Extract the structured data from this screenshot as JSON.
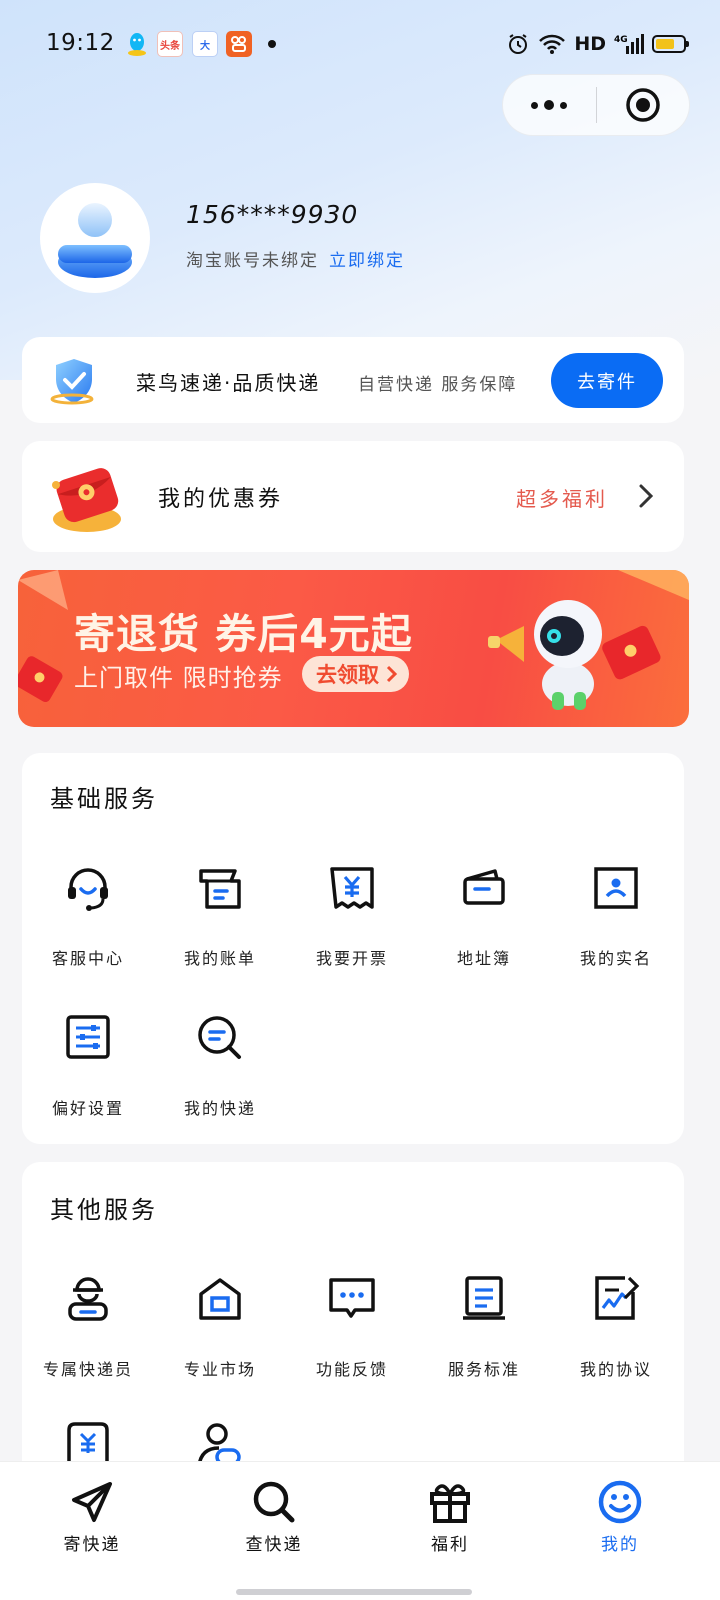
{
  "status_bar": {
    "time": "19:12",
    "network": "HD",
    "signal": "4G",
    "battery_level": 0.7
  },
  "status_icons": [
    {
      "name": "qq-icon",
      "color": "#12b7f5"
    },
    {
      "name": "toutiao-icon",
      "text": "头条",
      "color": "#e8453c"
    },
    {
      "name": "baidu-icon",
      "text": "大",
      "color": "#2e6bea"
    },
    {
      "name": "kuaishou-icon",
      "color": "#f06224"
    }
  ],
  "profile": {
    "phone": "156****9930",
    "bind_status": "淘宝账号未绑定",
    "bind_link": "立即绑定"
  },
  "promo": {
    "title": "菜鸟速递·品质快递",
    "subtitle": "自营快递 服务保障",
    "button": "去寄件"
  },
  "coupon": {
    "title": "我的优惠券",
    "right": "超多福利"
  },
  "banner": {
    "headline": "寄退货 券后4元起",
    "subline": "上门取件 限时抢券",
    "cta": "去领取"
  },
  "basic_services": {
    "title": "基础服务",
    "items": [
      {
        "label": "客服中心",
        "icon": "headset-icon"
      },
      {
        "label": "我的账单",
        "icon": "bill-icon"
      },
      {
        "label": "我要开票",
        "icon": "invoice-icon"
      },
      {
        "label": "地址簿",
        "icon": "address-book-icon"
      },
      {
        "label": "我的实名",
        "icon": "id-card-icon"
      },
      {
        "label": "偏好设置",
        "icon": "settings-sliders-icon"
      },
      {
        "label": "我的快递",
        "icon": "search-package-icon"
      }
    ]
  },
  "other_services": {
    "title": "其他服务",
    "items": [
      {
        "label": "专属快递员",
        "icon": "courier-icon"
      },
      {
        "label": "专业市场",
        "icon": "market-icon"
      },
      {
        "label": "功能反馈",
        "icon": "feedback-icon"
      },
      {
        "label": "服务标准",
        "icon": "standard-icon"
      },
      {
        "label": "我的协议",
        "icon": "agreement-icon"
      }
    ]
  },
  "tabbar": {
    "items": [
      {
        "label": "寄快递",
        "icon": "send-icon"
      },
      {
        "label": "查快递",
        "icon": "search-icon"
      },
      {
        "label": "福利",
        "icon": "gift-icon"
      },
      {
        "label": "我的",
        "icon": "smile-icon",
        "active": true
      }
    ]
  },
  "colors": {
    "accent": "#0a6cf4",
    "warm": "#e45a4e",
    "active_tab": "#1a6cf0"
  }
}
